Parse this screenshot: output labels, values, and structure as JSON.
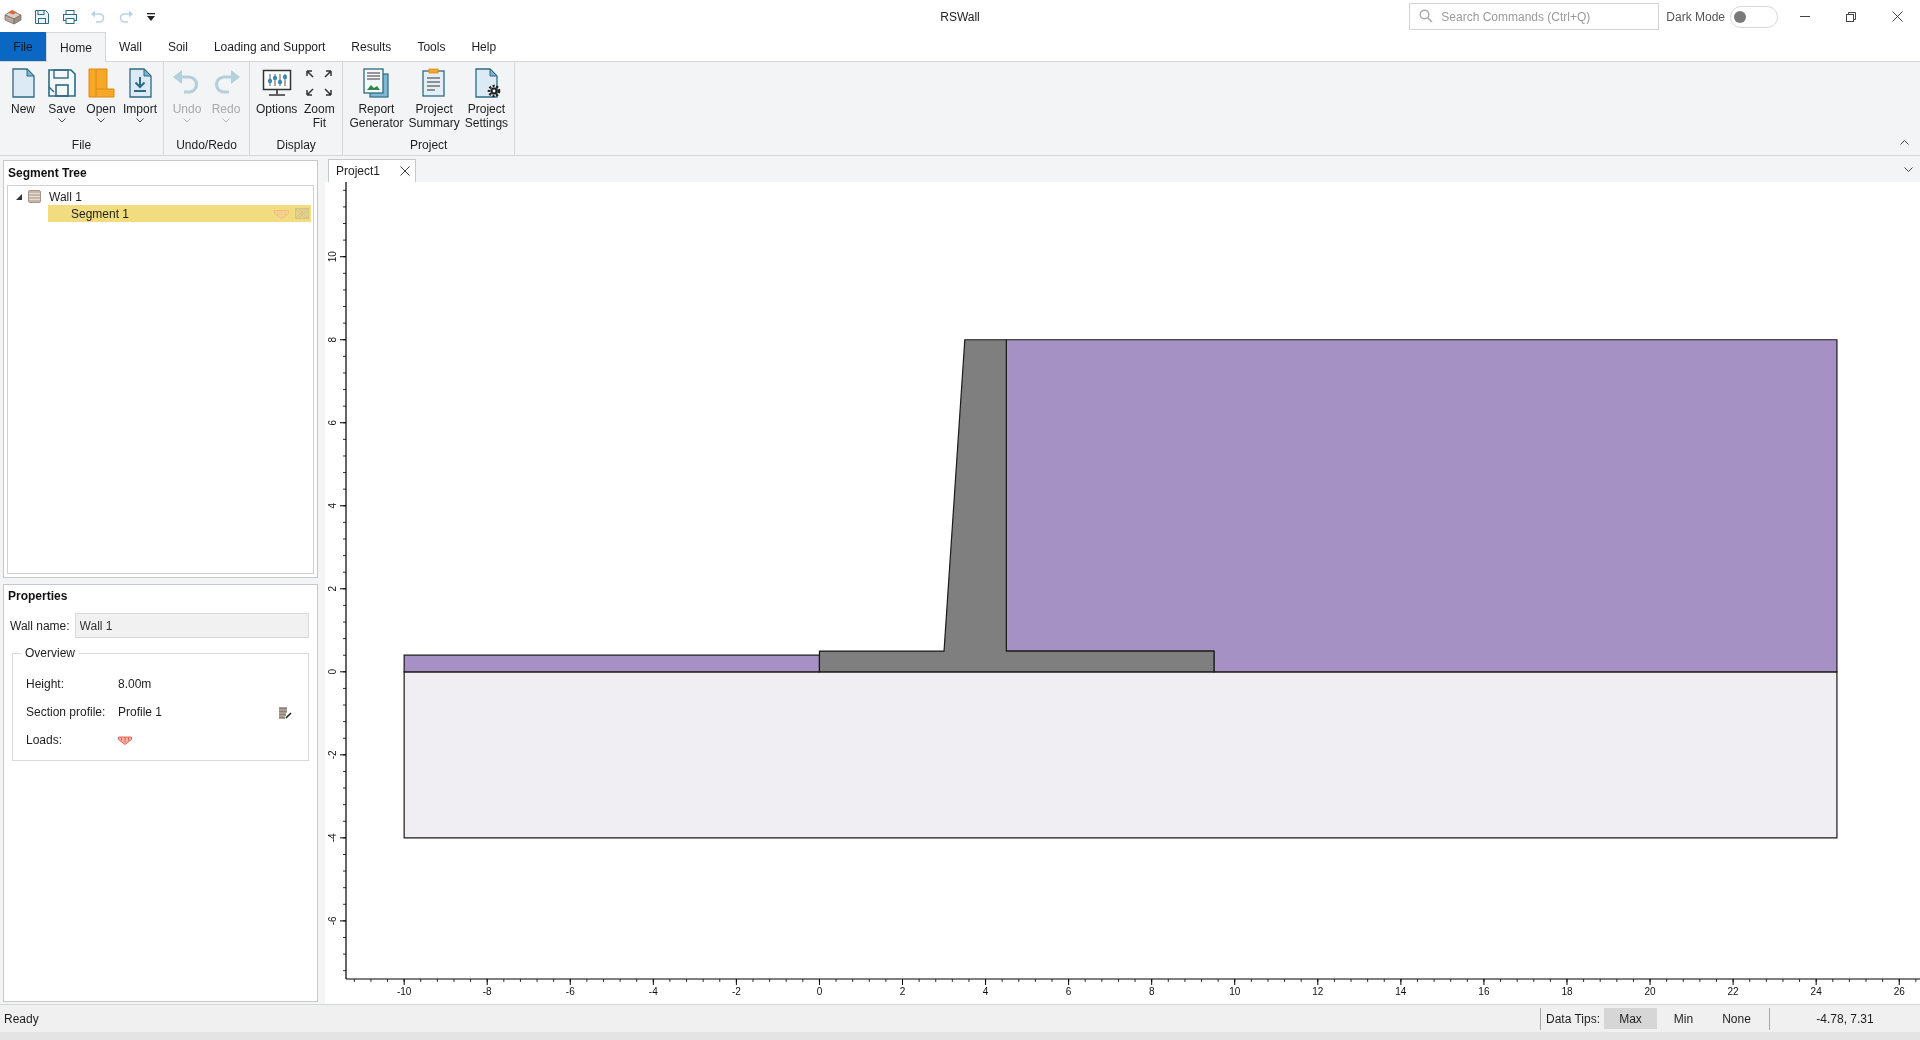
{
  "window": {
    "title": "RSWall"
  },
  "quick_access": [
    {
      "kind": "save",
      "disabled": false
    },
    {
      "kind": "print",
      "disabled": false
    },
    {
      "kind": "undo",
      "disabled": true
    },
    {
      "kind": "redo",
      "disabled": true
    },
    {
      "kind": "customize",
      "disabled": false
    }
  ],
  "search": {
    "placeholder": "Search Commands (Ctrl+Q)"
  },
  "dark_mode": {
    "label": "Dark Mode",
    "on": false
  },
  "ribbon_tabs": [
    {
      "label": "File",
      "kind": "backstage",
      "selected": false
    },
    {
      "label": "Home",
      "kind": "tab",
      "selected": true
    },
    {
      "label": "Wall",
      "kind": "tab",
      "selected": false
    },
    {
      "label": "Soil",
      "kind": "tab",
      "selected": false
    },
    {
      "label": "Loading and Support",
      "kind": "tab",
      "selected": false
    },
    {
      "label": "Results",
      "kind": "tab",
      "selected": false
    },
    {
      "label": "Tools",
      "kind": "tab",
      "selected": false
    },
    {
      "label": "Help",
      "kind": "tab",
      "selected": false
    }
  ],
  "ribbon": {
    "groups": [
      {
        "label": "File",
        "buttons": [
          {
            "kind": "new",
            "label": "New",
            "dropdown": false,
            "disabled": false
          },
          {
            "kind": "save",
            "label": "Save",
            "dropdown": true,
            "disabled": false
          },
          {
            "kind": "open",
            "label": "Open",
            "dropdown": true,
            "disabled": false
          },
          {
            "kind": "import",
            "label": "Import",
            "dropdown": true,
            "disabled": false
          }
        ]
      },
      {
        "label": "Undo/Redo",
        "buttons": [
          {
            "kind": "undo",
            "label": "Undo",
            "dropdown": true,
            "disabled": true
          },
          {
            "kind": "redo",
            "label": "Redo",
            "dropdown": true,
            "disabled": true
          }
        ]
      },
      {
        "label": "Display",
        "buttons": [
          {
            "kind": "options",
            "label": "Options",
            "dropdown": false,
            "disabled": false
          },
          {
            "kind": "zoom_fit",
            "label": "Zoom Fit",
            "dropdown": false,
            "disabled": false
          }
        ]
      },
      {
        "label": "Project",
        "buttons": [
          {
            "kind": "report",
            "label": "Report Generator",
            "dropdown": false,
            "disabled": false
          },
          {
            "kind": "summary",
            "label": "Project Summary",
            "dropdown": false,
            "disabled": false
          },
          {
            "kind": "settings",
            "label": "Project Settings",
            "dropdown": false,
            "disabled": false
          }
        ]
      }
    ]
  },
  "segment_tree": {
    "title": "Segment Tree",
    "items": [
      {
        "label": "Wall 1",
        "expanded": true,
        "selected": false,
        "children": [
          {
            "label": "Segment 1",
            "selected": true
          }
        ]
      }
    ]
  },
  "properties": {
    "title": "Properties",
    "wall_name": {
      "label": "Wall name:",
      "value": "Wall 1"
    },
    "overview": {
      "title": "Overview",
      "rows": [
        {
          "kind": "value",
          "label": "Height:",
          "value": "8.00m"
        },
        {
          "kind": "profile",
          "label": "Section profile:",
          "value": "Profile 1"
        },
        {
          "kind": "loads",
          "label": "Loads:"
        }
      ]
    }
  },
  "document_tabs": [
    {
      "label": "Project1",
      "selected": true
    }
  ],
  "view": {
    "chart_data": {
      "type": "area",
      "xlim": [
        -11.4,
        26.5
      ],
      "ylim": [
        -7.4,
        11.8
      ],
      "xticks": [
        -10,
        -8,
        -6,
        -4,
        -2,
        0,
        2,
        4,
        6,
        8,
        10,
        12,
        14,
        16,
        18,
        20,
        22,
        24,
        26
      ],
      "yticks": [
        -6,
        -4,
        -2,
        0,
        2,
        4,
        6,
        8,
        10
      ],
      "series": [
        {
          "color": "#f0eef2",
          "x": [
            -10,
            24.5,
            24.5,
            -10
          ],
          "values": [
            -4,
            -4,
            0,
            0
          ]
        },
        {
          "color": "#a691c4",
          "x": [
            -10,
            0,
            0,
            -10
          ],
          "values": [
            0,
            0,
            0.4,
            0.4
          ]
        },
        {
          "color": "#a691c4",
          "x": [
            4.5,
            24.5,
            24.5,
            9.5,
            9.5,
            4.5
          ],
          "values": [
            8,
            8,
            0,
            0,
            0.5,
            0.5
          ]
        },
        {
          "color": "#7f7f7f",
          "x": [
            0,
            9.5,
            9.5,
            4.5,
            4.5,
            3.5,
            3,
            0
          ],
          "values": [
            0,
            0,
            0.5,
            0.5,
            8,
            8,
            0.5,
            0.5
          ]
        }
      ]
    }
  },
  "status_bar": {
    "status": "Ready",
    "data_tips": {
      "label": "Data Tips:",
      "options": [
        {
          "label": "Max",
          "selected": true
        },
        {
          "label": "Min",
          "selected": false
        },
        {
          "label": "None",
          "selected": false
        }
      ]
    },
    "coordinates": "-4.78, 7.31"
  }
}
